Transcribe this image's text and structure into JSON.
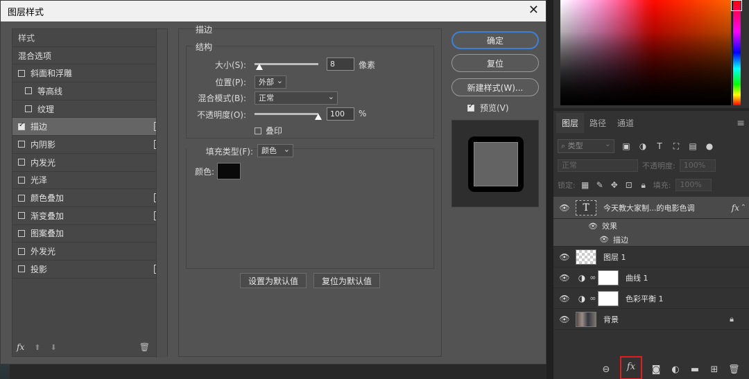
{
  "dialog": {
    "title": "图层样式",
    "style_list": {
      "header": "样式",
      "blend_options": "混合选项",
      "items": [
        {
          "label": "斜面和浮雕",
          "checked": false,
          "indent": false,
          "plus": false
        },
        {
          "label": "等高线",
          "checked": false,
          "indent": true,
          "plus": false
        },
        {
          "label": "纹理",
          "checked": false,
          "indent": true,
          "plus": false
        },
        {
          "label": "描边",
          "checked": true,
          "indent": false,
          "plus": true,
          "active": true
        },
        {
          "label": "内阴影",
          "checked": false,
          "indent": false,
          "plus": true
        },
        {
          "label": "内发光",
          "checked": false,
          "indent": false,
          "plus": false
        },
        {
          "label": "光泽",
          "checked": false,
          "indent": false,
          "plus": false
        },
        {
          "label": "颜色叠加",
          "checked": false,
          "indent": false,
          "plus": true
        },
        {
          "label": "渐变叠加",
          "checked": false,
          "indent": false,
          "plus": true
        },
        {
          "label": "图案叠加",
          "checked": false,
          "indent": false,
          "plus": false
        },
        {
          "label": "外发光",
          "checked": false,
          "indent": false,
          "plus": false
        },
        {
          "label": "投影",
          "checked": false,
          "indent": false,
          "plus": true
        }
      ],
      "footer_fx": "fx"
    },
    "stroke": {
      "section_title": "描边",
      "structure_title": "结构",
      "size_label": "大小(S):",
      "size_value": "8",
      "size_unit": "像素",
      "size_level": 0.08,
      "position_label": "位置(P):",
      "position_value": "外部",
      "blend_label": "混合模式(B):",
      "blend_value": "正常",
      "opacity_label": "不透明度(O):",
      "opacity_value": "100",
      "opacity_unit": "%",
      "opacity_level": 1.0,
      "overprint_label": "叠印",
      "fill_type_label": "填充类型(F):",
      "fill_type_value": "颜色",
      "color_label": "颜色:",
      "stroke_color": "#0a0a0a"
    },
    "set_default_label": "设置为默认值",
    "reset_default_label": "复位为默认值",
    "buttons": {
      "ok": "确定",
      "reset": "复位",
      "new_style": "新建样式(W)...",
      "preview": "预览(V)"
    }
  },
  "layers_panel": {
    "tabs": [
      "图层",
      "路径",
      "通道"
    ],
    "filter_kind": "类型",
    "blend_mode": "正常",
    "opacity_label": "不透明度:",
    "opacity_value": "100%",
    "lock_label": "锁定:",
    "fill_label": "填充:",
    "fill_value": "100%",
    "layers": {
      "text_layer": "今天教大家制...的电影色调",
      "text_fx": "fx",
      "effects_label": "效果",
      "stroke_effect": "描边",
      "layer1": "图层 1",
      "curves": "曲线 1",
      "color_balance": "色彩平衡 1",
      "background": "背景"
    },
    "bottom_fx": "fx"
  }
}
